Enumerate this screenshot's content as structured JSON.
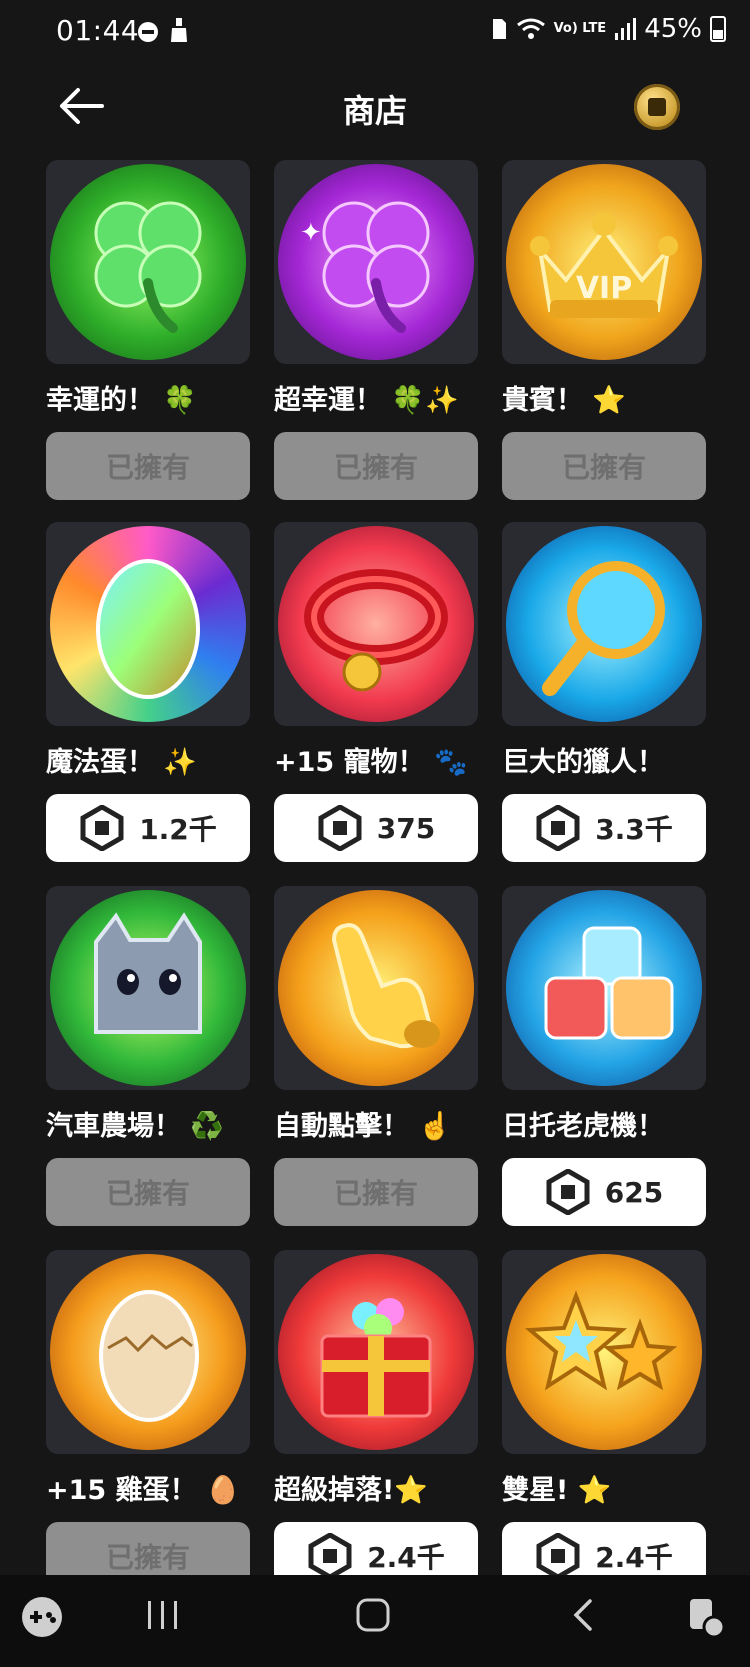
{
  "status": {
    "time": "01:44",
    "signal": "Vo) LTE",
    "battery": "45%"
  },
  "header": {
    "title": "商店"
  },
  "items": [
    {
      "name": "幸運的！ 🍀",
      "state": "owned",
      "label": "已擁有",
      "art": "clover-icon",
      "colors": [
        "#9cff6b",
        "#2fae2a",
        "#0e5a12"
      ]
    },
    {
      "name": "超幸運！ 🍀✨",
      "state": "owned",
      "label": "已擁有",
      "art": "purple-clover-icon",
      "colors": [
        "#f59cff",
        "#a528d6",
        "#4b0b73"
      ]
    },
    {
      "name": "貴賓！ ⭐",
      "state": "owned",
      "label": "已擁有",
      "art": "vip-crown-icon",
      "colors": [
        "#fff07a",
        "#f0a51c",
        "#a44a07"
      ]
    },
    {
      "name": "魔法蛋！ ✨",
      "state": "price",
      "price": "1.2千",
      "art": "rainbow-egg-icon",
      "colors": [
        "#ffe46b",
        "#44d08a",
        "#6b2bd0"
      ]
    },
    {
      "name": "+15 寵物！ 🐾",
      "state": "price",
      "price": "375",
      "art": "pet-collar-icon",
      "colors": [
        "#ffb0a0",
        "#f23a4e",
        "#7c0b2a"
      ]
    },
    {
      "name": "巨大的獵人！",
      "state": "price",
      "price": "3.3千",
      "art": "magnifier-icon",
      "colors": [
        "#a8f4ff",
        "#19a8e8",
        "#0a3c8c"
      ]
    },
    {
      "name": "汽車農場！ ♻️",
      "state": "owned",
      "label": "已擁有",
      "art": "cat-pet-icon",
      "colors": [
        "#c8ff6b",
        "#31b83a",
        "#0b4d18"
      ]
    },
    {
      "name": "自動點擊！ ☝️",
      "state": "owned",
      "label": "已擁有",
      "art": "pointer-hand-icon",
      "colors": [
        "#fff27a",
        "#f5a01a",
        "#a8420a"
      ]
    },
    {
      "name": "日托老虎機！",
      "state": "price",
      "price": "625",
      "art": "dice-cubes-icon",
      "colors": [
        "#b7f5ff",
        "#23a4e6",
        "#0b3d8a"
      ]
    },
    {
      "name": "+15 雞蛋！ 🥚",
      "state": "owned",
      "label": "已擁有",
      "art": "cracked-egg-icon",
      "colors": [
        "#fff49a",
        "#f59c1c",
        "#a13f08"
      ]
    },
    {
      "name": "超級掉落!⭐",
      "state": "price",
      "price": "2.4千",
      "art": "gift-box-icon",
      "colors": [
        "#ffc8a0",
        "#f03a3a",
        "#7a0a1e"
      ]
    },
    {
      "name": "雙星! ⭐",
      "state": "price",
      "price": "2.4千",
      "art": "double-star-icon",
      "colors": [
        "#fff27a",
        "#f5a21c",
        "#a8460a"
      ]
    }
  ]
}
